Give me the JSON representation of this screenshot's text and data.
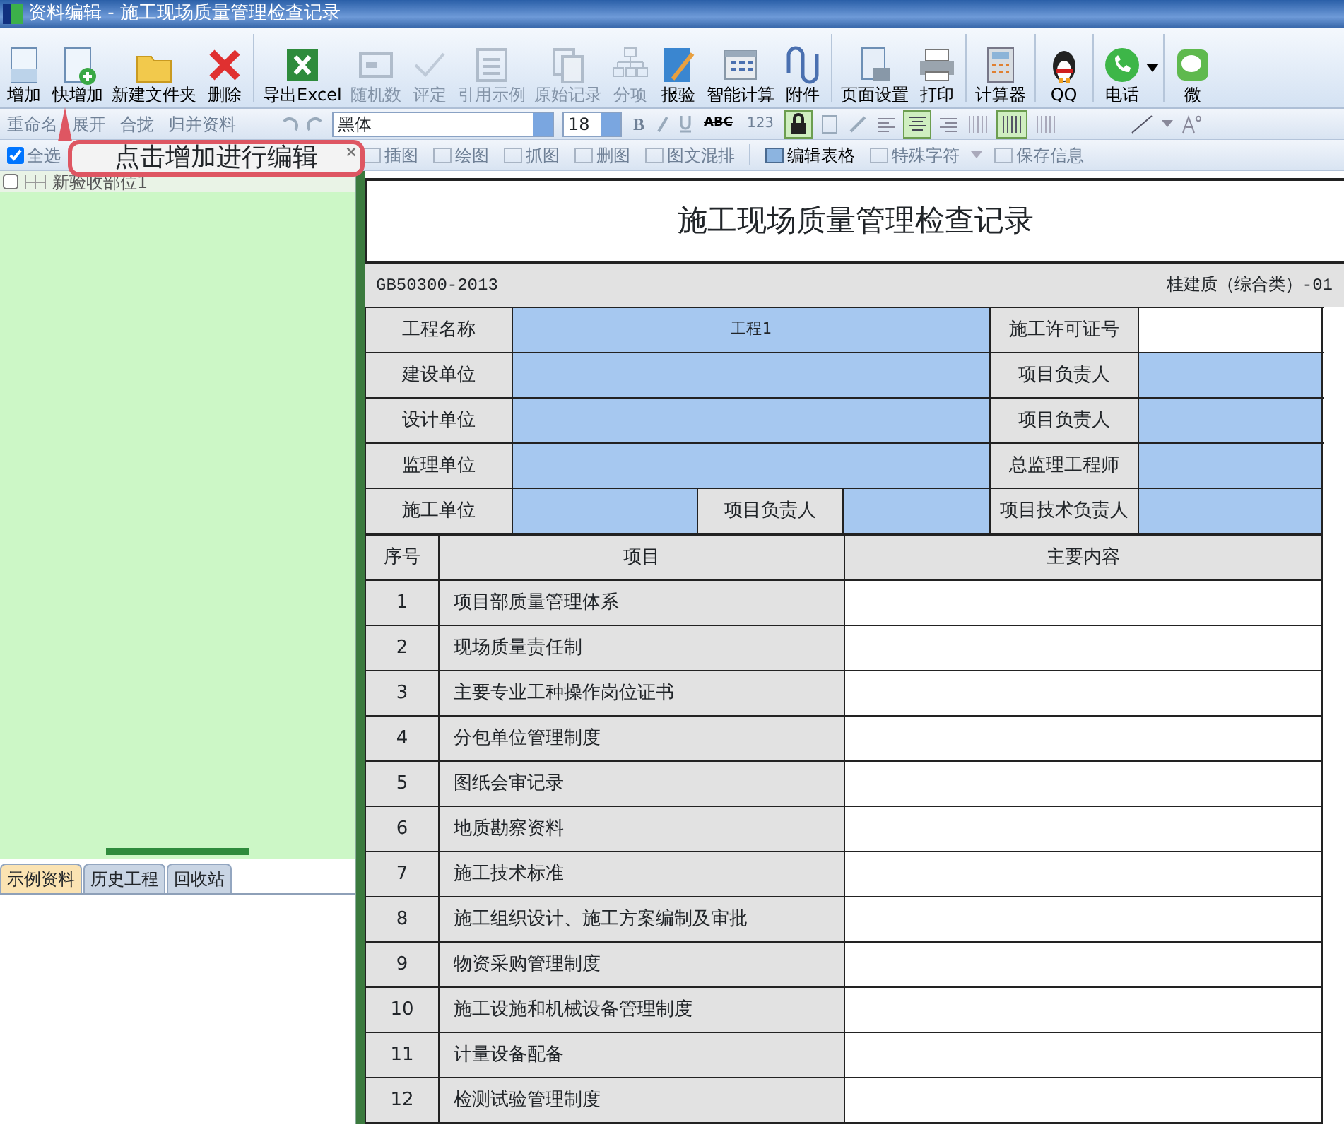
{
  "window": {
    "title": "资料编辑 - 施工现场质量管理检查记录"
  },
  "toolbar": [
    {
      "label": "增加",
      "disabled": false
    },
    {
      "label": "快增加",
      "disabled": false
    },
    {
      "label": "新建文件夹",
      "disabled": false
    },
    {
      "label": "删除",
      "disabled": false
    },
    {
      "label": "导出Excel",
      "disabled": false
    },
    {
      "label": "随机数",
      "disabled": true
    },
    {
      "label": "评定",
      "disabled": true
    },
    {
      "label": "引用示例",
      "disabled": true
    },
    {
      "label": "原始记录",
      "disabled": true
    },
    {
      "label": "分项",
      "disabled": true
    },
    {
      "label": "报验",
      "disabled": false
    },
    {
      "label": "智能计算",
      "disabled": false
    },
    {
      "label": "附件",
      "disabled": false
    },
    {
      "label": "页面设置",
      "disabled": false
    },
    {
      "label": "打印",
      "disabled": false
    },
    {
      "label": "计算器",
      "disabled": false
    },
    {
      "label": "QQ",
      "disabled": false
    },
    {
      "label": "电话",
      "disabled": false
    },
    {
      "label": "微",
      "disabled": false
    }
  ],
  "tree_toolbar": [
    {
      "label": "重命名",
      "disabled": true
    },
    {
      "label": "展开",
      "disabled": true
    },
    {
      "label": "合拢",
      "disabled": true
    },
    {
      "label": "归并资料",
      "disabled": true
    }
  ],
  "select_all": {
    "label": "全选",
    "checked": true
  },
  "format_bar": {
    "font": "黑体",
    "size": "18",
    "bold_label": "B",
    "strike_label": "ABC",
    "number_label": "123",
    "lock_on": true,
    "align_center_on": true,
    "distribute_on": true
  },
  "insert_bar": [
    {
      "label": "插图",
      "disabled": true
    },
    {
      "label": "绘图",
      "disabled": true
    },
    {
      "label": "抓图",
      "disabled": true
    },
    {
      "label": "删图",
      "disabled": true
    },
    {
      "label": "图文混排",
      "disabled": true
    },
    {
      "label": "编辑表格",
      "disabled": false
    },
    {
      "label": "特殊字符",
      "disabled": true
    },
    {
      "label": "保存信息",
      "disabled": true
    }
  ],
  "tooltip": {
    "text": "点击增加进行编辑"
  },
  "tree": [
    {
      "label": "新验收部位1",
      "checked": false
    }
  ],
  "bottom_tabs": [
    {
      "label": "示例资料",
      "selected": true
    },
    {
      "label": "历史工程",
      "selected": false
    },
    {
      "label": "回收站",
      "selected": false
    }
  ],
  "document": {
    "title": "施工现场质量管理检查记录",
    "code": "GB50300-2013",
    "form_no": "桂建质（综合类）-01",
    "info_rows": [
      {
        "kind": "pair",
        "cells": [
          {
            "kind": "label",
            "text": "工程名称"
          },
          {
            "kind": "value",
            "text": "工程1",
            "highlighted": true
          },
          {
            "kind": "label",
            "text": "施工许可证号"
          },
          {
            "kind": "value",
            "highlighted": false
          }
        ]
      },
      {
        "kind": "pair",
        "cells": [
          {
            "kind": "label",
            "text": "建设单位"
          },
          {
            "kind": "value",
            "highlighted": true
          },
          {
            "kind": "label",
            "text": "项目负责人"
          },
          {
            "kind": "value",
            "highlighted": true
          }
        ]
      },
      {
        "kind": "pair",
        "cells": [
          {
            "kind": "label",
            "text": "设计单位"
          },
          {
            "kind": "value",
            "highlighted": true
          },
          {
            "kind": "label",
            "text": "项目负责人"
          },
          {
            "kind": "value",
            "highlighted": true
          }
        ]
      },
      {
        "kind": "pair",
        "cells": [
          {
            "kind": "label",
            "text": "监理单位"
          },
          {
            "kind": "value",
            "highlighted": true
          },
          {
            "kind": "label",
            "text": "总监理工程师"
          },
          {
            "kind": "value",
            "highlighted": true
          }
        ]
      },
      {
        "kind": "triple",
        "cells": [
          {
            "kind": "label",
            "text": "施工单位"
          },
          {
            "kind": "value",
            "highlighted": true
          },
          {
            "kind": "label",
            "text": "项目负责人"
          },
          {
            "kind": "value",
            "highlighted": true
          },
          {
            "kind": "label",
            "text": "项目技术负责人"
          },
          {
            "kind": "value",
            "highlighted": true
          }
        ]
      }
    ],
    "columns": [
      "序号",
      "项目",
      "主要内容"
    ],
    "rows": [
      [
        "1",
        "项目部质量管理体系"
      ],
      [
        "2",
        "现场质量责任制"
      ],
      [
        "3",
        "主要专业工种操作岗位证书"
      ],
      [
        "4",
        "分包单位管理制度"
      ],
      [
        "5",
        "图纸会审记录"
      ],
      [
        "6",
        "地质勘察资料"
      ],
      [
        "7",
        "施工技术标准"
      ],
      [
        "8",
        "施工组织设计、施工方案编制及审批"
      ],
      [
        "9",
        "物资采购管理制度"
      ],
      [
        "10",
        "施工设施和机械设备管理制度"
      ],
      [
        "11",
        "计量设备配备"
      ],
      [
        "12",
        "检测试验管理制度"
      ]
    ]
  }
}
